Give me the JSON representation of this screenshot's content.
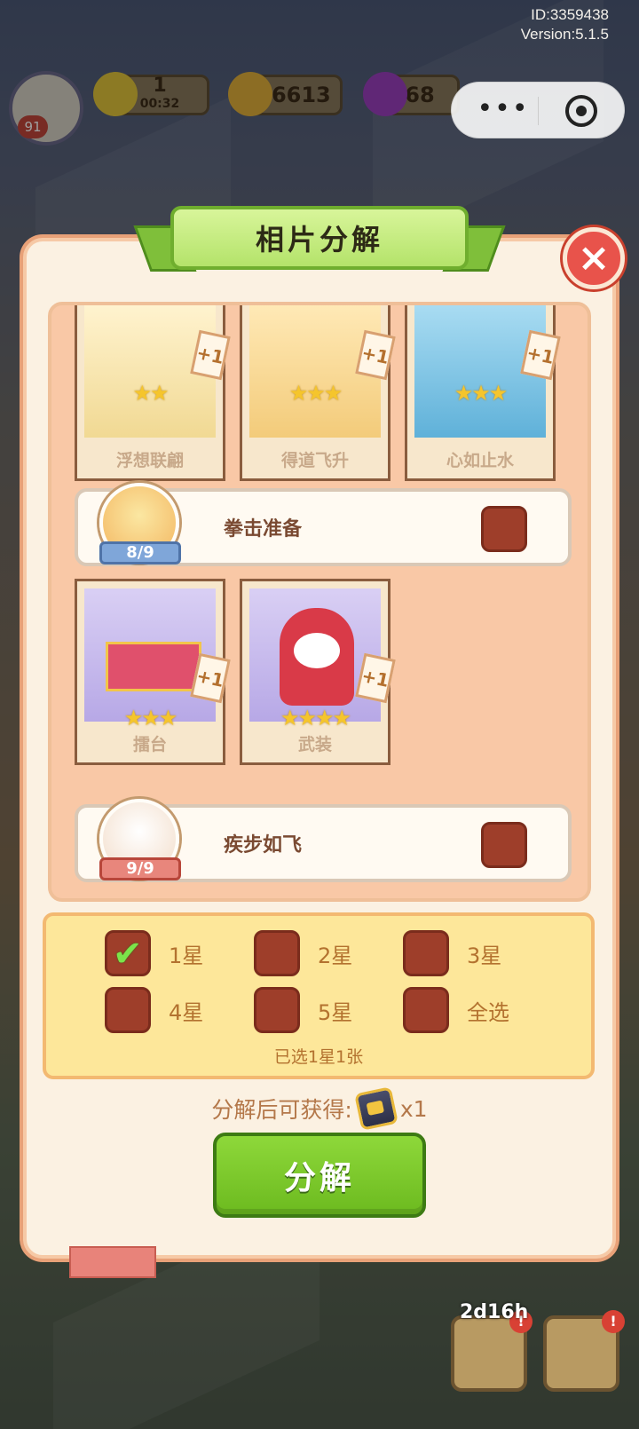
{
  "status": {
    "id_label": "ID:3359438",
    "version_label": "Version:5.1.5"
  },
  "hud": {
    "energy": {
      "value": "1",
      "timer": "00:32"
    },
    "coins": "26613",
    "gems": "68",
    "level": "91"
  },
  "dialog": {
    "title": "相片分解",
    "close_label": "×",
    "top_cards": [
      {
        "name": "浮想联翩",
        "stars": 2
      },
      {
        "name": "得道飞升",
        "stars": 3
      },
      {
        "name": "心如止水",
        "stars": 3
      }
    ],
    "sets": [
      {
        "name": "拳击准备",
        "progress": "8/9",
        "cards": [
          {
            "name": "擂台",
            "stars": 3
          },
          {
            "name": "武装",
            "stars": 4
          }
        ]
      },
      {
        "name": "疾步如飞",
        "progress": "9/9"
      }
    ],
    "plus_label": "+1",
    "filters": [
      {
        "label": "1星",
        "checked": true
      },
      {
        "label": "2星",
        "checked": false
      },
      {
        "label": "3星",
        "checked": false
      },
      {
        "label": "4星",
        "checked": false
      },
      {
        "label": "5星",
        "checked": false
      },
      {
        "label": "全选",
        "checked": false
      }
    ],
    "selected_info": "已选1星1张",
    "reward_prefix": "分解后可获得:",
    "reward_qty": "x1",
    "decompose_label": "分解"
  },
  "bottom": {
    "timer": "2d16h"
  },
  "colors": {
    "accent_green": "#7fbf3a",
    "checkbox": "#9e3e2a",
    "panel_yellow": "#fde79a"
  }
}
